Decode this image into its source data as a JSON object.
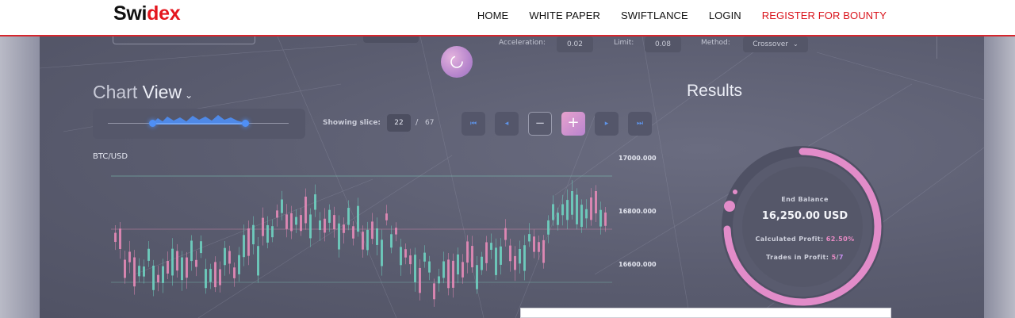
{
  "nav": {
    "logo_part1": "Swi",
    "logo_part2": "dex",
    "items": [
      "HOME",
      "WHITE PAPER",
      "SWIFTLANCE",
      "LOGIN",
      "REGISTER FOR BOUNTY"
    ]
  },
  "params": {
    "acceleration_label": "Acceleration:",
    "acceleration_value": "0.02",
    "limit_label": "Limit:",
    "limit_value": "0.08",
    "method_label": "Method:",
    "method_value": "Crossover"
  },
  "chart_view": {
    "title_light": "Chart",
    "title_bold": "View",
    "pair": "BTC/USD",
    "y_ticks": [
      "17000.000",
      "16800.000",
      "16600.000"
    ]
  },
  "slice": {
    "label": "Showing slice:",
    "current": "22",
    "separator": "/",
    "total": "67"
  },
  "results": {
    "title": "Results",
    "end_balance_label": "End Balance",
    "end_balance_value": "16,250.00 USD",
    "profit_label": "Calculated Profit:",
    "profit_value": "62.50%",
    "profit_fraction": 0.625,
    "trades_label": "Trades in Profit:",
    "trades_profit": "5",
    "trades_sep": "/",
    "trades_total": "7"
  },
  "colors": {
    "accent_red": "#d6262d",
    "bull_candle": "#6fd3c2",
    "bear_candle": "#e88bb8",
    "gauge_pink": "#e28cc9",
    "slider_blue": "#4f8ff5"
  },
  "icons": [
    "spinner-icon",
    "chevron-down-icon",
    "first-page-icon",
    "prev-icon",
    "minus-icon",
    "plus-icon",
    "next-icon",
    "last-page-icon"
  ]
}
